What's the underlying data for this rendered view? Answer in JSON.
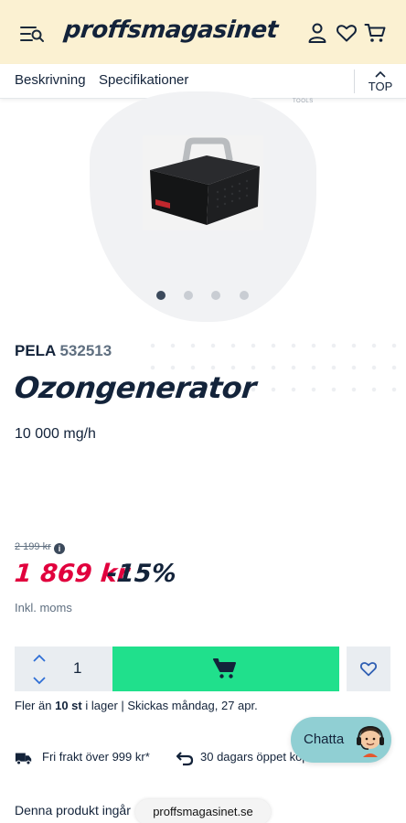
{
  "header": {
    "logo": "proffsmagasinet",
    "icons": [
      "menu-search-icon",
      "user-icon",
      "heart-icon",
      "cart-icon"
    ],
    "background": "#fbf1d2"
  },
  "tabs": {
    "description": "Beskrivning",
    "specifications": "Specifikationer",
    "top": "TOP"
  },
  "gallery": {
    "brand_mark": "TOOLS",
    "dots": 4,
    "active_dot": 1
  },
  "product": {
    "brand": "PELA",
    "article_number": "532513",
    "name": "Ozongenerator",
    "subtitle": "10 000 mg/h",
    "old_price": "2 199 kr",
    "price": "1 869 kr",
    "discount": "-15%",
    "vat_note": "Inkl. moms"
  },
  "purchase": {
    "quantity": "1",
    "stock_prefix": "Fler än",
    "stock_qty": "10 st",
    "stock_suffix": "i lager | Skickas måndag, 27 apr."
  },
  "usps": {
    "shipping": "Fri frakt över 999 kr*",
    "returns": "30 dagars öppet köp"
  },
  "chat": {
    "label": "Chatta"
  },
  "footer": {
    "bundle_text": "Denna produkt ingår",
    "url": "proffsmagasinet.se"
  },
  "colors": {
    "accent_green": "#20e08c",
    "price_red": "#e1003d",
    "navy": "#13233a",
    "chat_teal": "#90cfd3"
  }
}
